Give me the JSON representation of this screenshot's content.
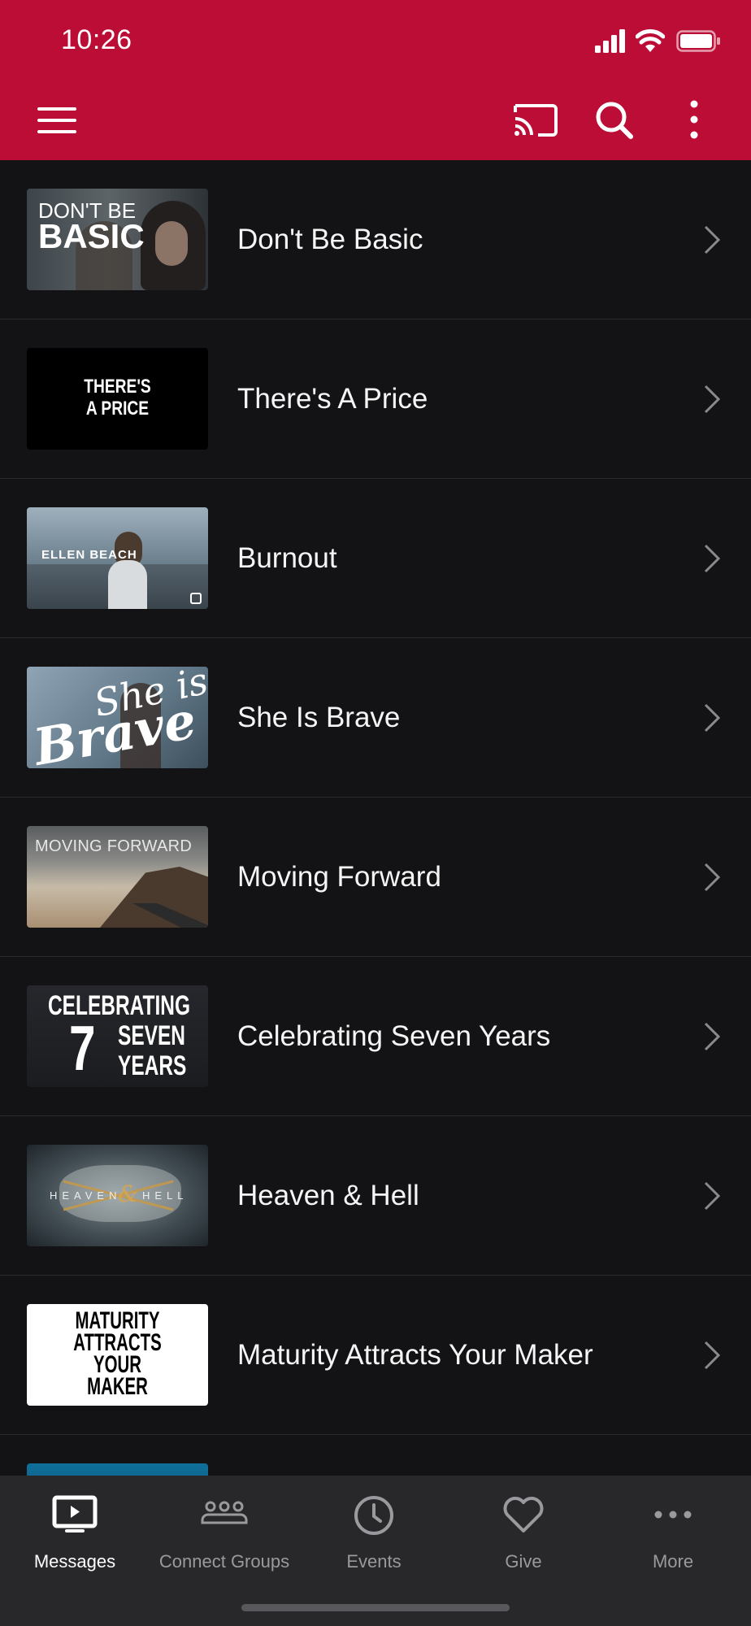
{
  "status_bar": {
    "time": "10:26"
  },
  "header": {
    "menu_icon": "hamburger-menu-icon",
    "cast_icon": "cast-icon",
    "search_icon": "search-icon",
    "more_icon": "vertical-dots-icon",
    "brand_color": "#bb0d35"
  },
  "series": [
    {
      "title": "Don't Be Basic",
      "thumb_text": [
        "DON'T BE",
        "BASIC"
      ]
    },
    {
      "title": "There's A Price",
      "thumb_text": [
        "THERE'S",
        "A PRICE"
      ]
    },
    {
      "title": "Burnout",
      "thumb_text": [
        "ELLEN BEACH"
      ]
    },
    {
      "title": "She Is Brave",
      "thumb_text": [
        "She is",
        "Brave"
      ]
    },
    {
      "title": "Moving Forward",
      "thumb_text": [
        "MOVING FORWARD"
      ]
    },
    {
      "title": "Celebrating Seven Years",
      "thumb_text": [
        "CELEBRATING",
        "7",
        "SEVEN",
        "YEARS"
      ]
    },
    {
      "title": "Heaven & Hell",
      "thumb_text": [
        "HEAVEN",
        "&",
        "HELL"
      ]
    },
    {
      "title": "Maturity Attracts Your Maker",
      "thumb_text": [
        "MATURITY",
        "ATTRACTS",
        "YOUR",
        "MAKER"
      ]
    }
  ],
  "tabs": [
    {
      "label": "Messages",
      "icon": "play-screen-icon",
      "active": true
    },
    {
      "label": "Connect Groups",
      "icon": "groups-icon",
      "active": false
    },
    {
      "label": "Events",
      "icon": "clock-icon",
      "active": false
    },
    {
      "label": "Give",
      "icon": "heart-icon",
      "active": false
    },
    {
      "label": "More",
      "icon": "horizontal-dots-icon",
      "active": false
    }
  ]
}
